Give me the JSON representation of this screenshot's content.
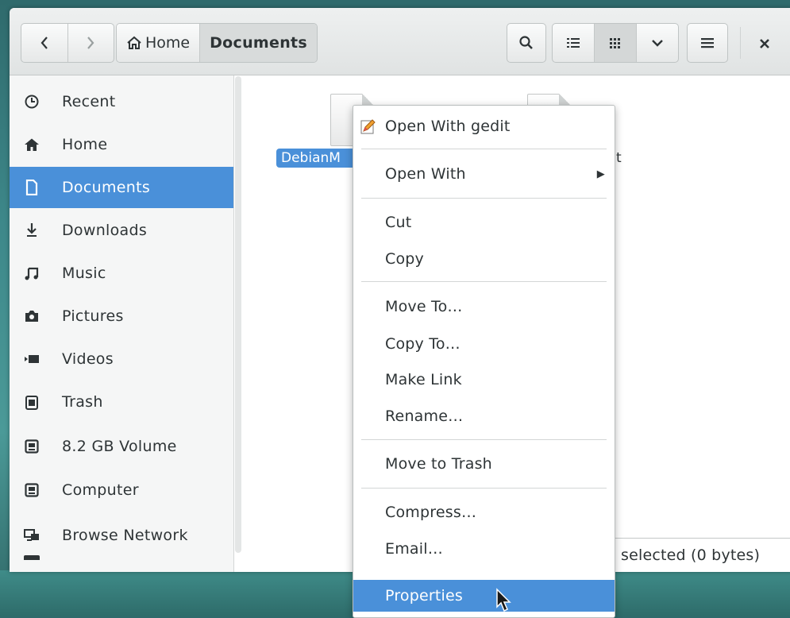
{
  "toolbar": {
    "back_icon": "‹",
    "forward_icon": "›",
    "breadcrumbs": [
      "Home",
      "Documents"
    ],
    "buttons": [
      "search-icon",
      "list-view-icon",
      "grid-view-icon",
      "view-options-icon",
      "menu-icon",
      "close-icon"
    ]
  },
  "sidebar": {
    "items": [
      {
        "label": "Recent",
        "icon": "clock-icon"
      },
      {
        "label": "Home",
        "icon": "home-icon"
      },
      {
        "label": "Documents",
        "icon": "document-icon",
        "selected": true
      },
      {
        "label": "Downloads",
        "icon": "download-icon"
      },
      {
        "label": "Music",
        "icon": "music-icon"
      },
      {
        "label": "Pictures",
        "icon": "camera-icon"
      },
      {
        "label": "Videos",
        "icon": "video-icon"
      },
      {
        "label": "Trash",
        "icon": "trash-icon"
      },
      {
        "label": "8.2 GB Volume",
        "icon": "drive-icon"
      },
      {
        "label": "Computer",
        "icon": "drive-icon"
      },
      {
        "label": "Browse Network",
        "icon": "network-icon"
      }
    ]
  },
  "files": [
    {
      "label": "DebianM",
      "selected": true
    },
    {
      "label": "t",
      "selected": false
    }
  ],
  "status": {
    "text": "selected (0 bytes)"
  },
  "context_menu": {
    "items": {
      "open_with_gedit": "Open With gedit",
      "open_with": "Open With",
      "cut": "Cut",
      "copy": "Copy",
      "move_to": "Move To…",
      "copy_to": "Copy To…",
      "make_link": "Make Link",
      "rename": "Rename…",
      "move_to_trash": "Move to Trash",
      "compress": "Compress…",
      "email": "Email…",
      "properties": "Properties"
    },
    "highlighted": "Properties"
  },
  "colors": {
    "accent": "#4a90d9",
    "desktop": "#3d8789"
  }
}
